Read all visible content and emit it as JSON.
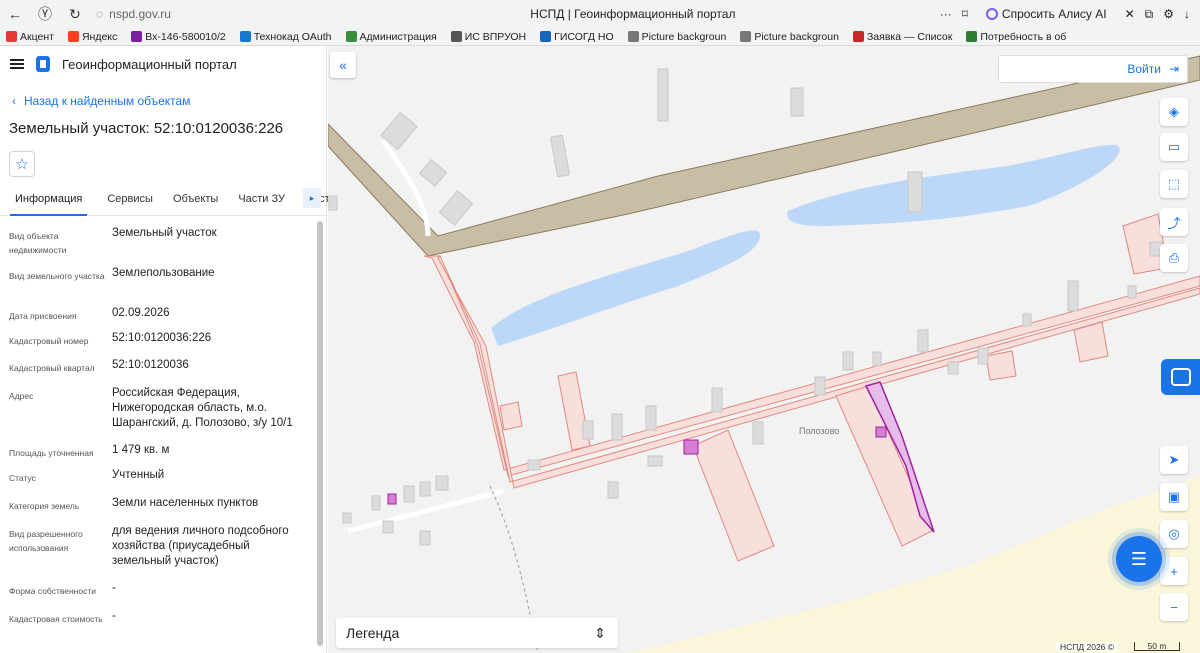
{
  "browser": {
    "address": "nspd.gov.ru",
    "tab_title": "НСПД | Геоинформационный портал",
    "alice_label": "Спросить Алису AI",
    "bookmarks": [
      {
        "label": "Акцент",
        "color": "#e53935"
      },
      {
        "label": "Яндекс",
        "color": "#fc3f1d"
      },
      {
        "label": "Вх-146-580010/2",
        "color": "#7b1fa2"
      },
      {
        "label": "Технокад OAuth",
        "color": "#1976d2"
      },
      {
        "label": "Администрация",
        "color": "#388e3c"
      },
      {
        "label": "ИС ВПРУОН",
        "color": "#555555"
      },
      {
        "label": "ГИСОГД НО",
        "color": "#1565c0"
      },
      {
        "label": "Picture backgroun",
        "color": "#777777"
      },
      {
        "label": "Picture backgroun",
        "color": "#777777"
      },
      {
        "label": "Заявка — Список",
        "color": "#c62828"
      },
      {
        "label": "Потребность в об",
        "color": "#2e7d32"
      }
    ]
  },
  "app": {
    "title": "Геоинформационный портал",
    "back_label": "Назад к найденным объектам",
    "object_title": "Земельный участок: 52:10:0120036:226",
    "tabs": [
      "Информация",
      "Сервисы",
      "Объекты",
      "Части ЗУ",
      "Состав"
    ],
    "active_tab": "Информация",
    "properties": [
      {
        "label": "Вид объекта недвижимости",
        "value": "Земельный участок"
      },
      {
        "label": "Вид земельного участка",
        "value": "Землепользование"
      },
      {
        "label": "Дата присвоения",
        "value": "02.09.2026"
      },
      {
        "label": "Кадастровый номер",
        "value": "52:10:0120036:226"
      },
      {
        "label": "Кадастровый квартал",
        "value": "52:10:0120036"
      },
      {
        "label": "Адрес",
        "value": "Российская Федерация, Нижегородская область, м.о. Шарангский, д. Полозово, з/у 10/1"
      },
      {
        "label": "Площадь уточненная",
        "value": "1 479 кв. м"
      },
      {
        "label": "Статус",
        "value": "Учтенный"
      },
      {
        "label": "Категория земель",
        "value": "Земли населенных пунктов"
      },
      {
        "label": "Вид разрешенного использования",
        "value": "для ведения личного подсобного хозяйства (приусадебный земельный участок)"
      },
      {
        "label": "Форма собственности",
        "value": "-"
      },
      {
        "label": "Кадастровая стоимость",
        "value": "-"
      }
    ]
  },
  "map": {
    "login_label": "Войти",
    "legend_label": "Легенда",
    "village_label": "Полозово",
    "copyright": "НСПД 2026 ©",
    "scale_label": "50 m",
    "colors": {
      "water": "#bcd7f7",
      "parcel_fill": "#f8dfdc",
      "parcel_stroke": "#e0897f",
      "selected_stroke": "#a020a0",
      "building": "#dcdcdc",
      "sand": "#fbf6d9",
      "accent": "#1a73e8"
    }
  }
}
